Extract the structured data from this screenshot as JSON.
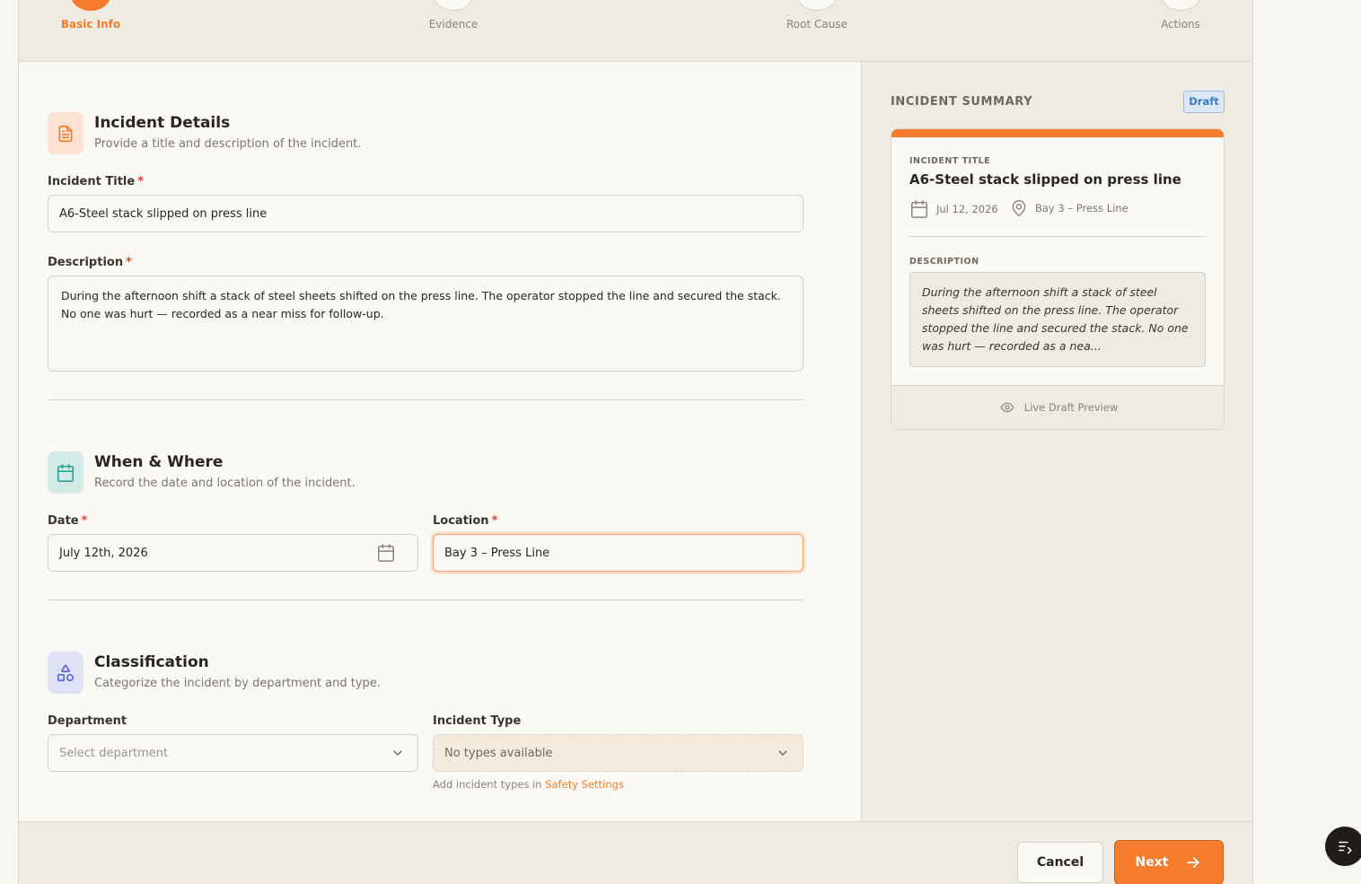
{
  "stepper": {
    "steps": [
      {
        "label": "Basic Info",
        "active": true
      },
      {
        "label": "Evidence",
        "active": false
      },
      {
        "label": "Root Cause",
        "active": false
      },
      {
        "label": "Actions",
        "active": false
      }
    ]
  },
  "details": {
    "title": "Incident Details",
    "subtitle": "Provide a title and description of the incident.",
    "title_label": "Incident Title",
    "title_value": "A6-Steel stack slipped on press line",
    "description_label": "Description",
    "description_value": "During the afternoon shift a stack of steel sheets shifted on the press line. The operator stopped the line and secured the stack. No one was hurt — recorded as a near miss for follow-up.",
    "required_mark": "*"
  },
  "when_where": {
    "title": "When & Where",
    "subtitle": "Record the date and location of the incident.",
    "date_label": "Date",
    "date_value": "July 12th, 2026",
    "location_label": "Location",
    "location_value": "Bay 3 – Press Line"
  },
  "classification": {
    "title": "Classification",
    "subtitle": "Categorize the incident by department and type.",
    "department_label": "Department",
    "department_placeholder": "Select department",
    "type_label": "Incident Type",
    "type_value": "No types available",
    "helper_text": "Add incident types in",
    "helper_link": "Safety Settings"
  },
  "summary": {
    "heading": "INCIDENT SUMMARY",
    "badge": "Draft",
    "title_key": "INCIDENT TITLE",
    "title_value": "A6-Steel stack slipped on press line",
    "date": "Jul 12, 2026",
    "location": "Bay 3 – Press Line",
    "description_key": "DESCRIPTION",
    "description_value": "During the afternoon shift a stack of steel sheets shifted on the press line. The operator stopped the line and secured the stack. No one was hurt — recorded as a nea...",
    "footer": "Live Draft Preview"
  },
  "footer": {
    "cancel": "Cancel",
    "next": "Next"
  },
  "colors": {
    "accent": "#f47c2c",
    "required": "#e0452c",
    "badge": "#3d7bc4"
  }
}
